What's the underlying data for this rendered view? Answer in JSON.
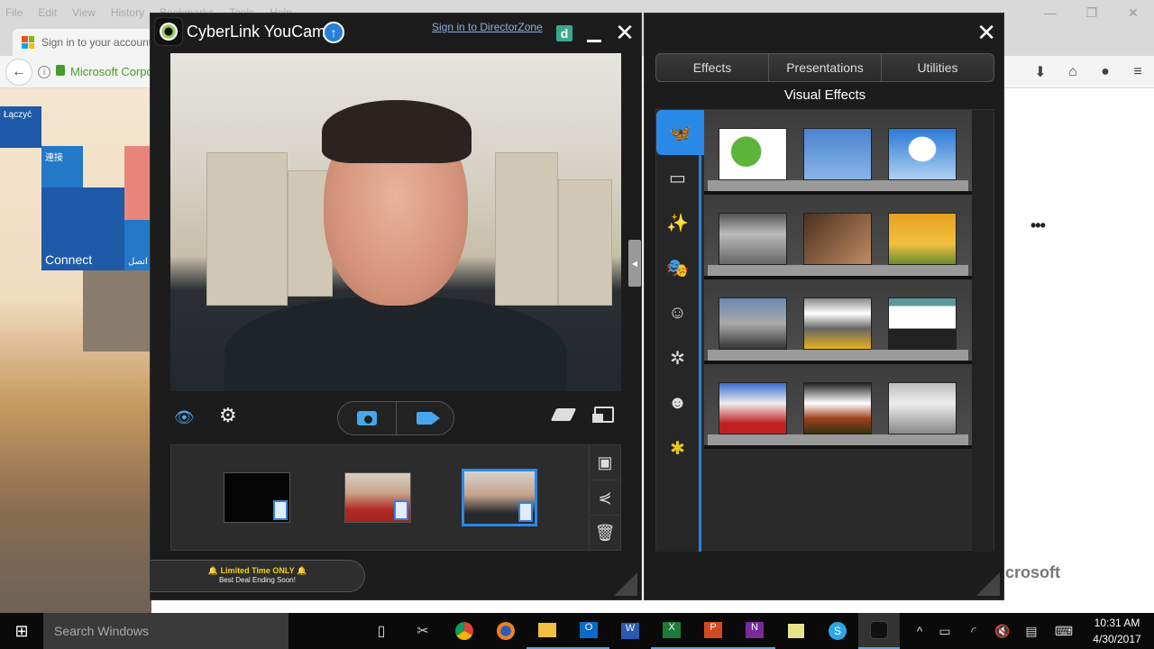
{
  "browser": {
    "menu": [
      "File",
      "Edit",
      "View",
      "History",
      "Bookmarks",
      "Tools",
      "Help"
    ],
    "tab_title": "Sign in to your account",
    "url_identity": "Microsoft Corpo",
    "window_controls": [
      "minimize",
      "restore",
      "close"
    ],
    "toolbar_icons": [
      "pocket-icon",
      "download-icon",
      "home-icon",
      "extensions-icon",
      "menu-icon"
    ],
    "tiles": [
      "Łączyć",
      "連接",
      "Connect",
      "اتصل"
    ],
    "more_label": "•••",
    "footer_logo_text": "Microsoft"
  },
  "youcam": {
    "title": "CyberLink YouCam",
    "signin_link": "Sign in to DirectorZone",
    "directorzone_icon_letter": "d",
    "controls": {
      "left": [
        "eye-icon",
        "settings-gear-icon"
      ],
      "capture": [
        "snapshot-camera-icon",
        "record-video-icon"
      ],
      "right": [
        "eraser-icon",
        "window-mode-icon"
      ]
    },
    "gallery": {
      "items": [
        {
          "type": "video",
          "description": "black video clip",
          "selected": false
        },
        {
          "type": "video",
          "description": "man in red shirt",
          "selected": false
        },
        {
          "type": "video",
          "description": "man in kitchen",
          "selected": true
        }
      ],
      "side_actions": [
        "import-to-gallery-icon",
        "share-icon",
        "delete-icon"
      ]
    },
    "promo": {
      "line1": "Limited Time ONLY",
      "line2": "Best Deal Ending Soon!"
    }
  },
  "effects": {
    "tabs": [
      "Effects",
      "Presentations",
      "Utilities"
    ],
    "active_tab": "Effects",
    "heading": "Visual Effects",
    "categories": [
      "scenes-icon",
      "frames-icon",
      "magic-wand-icon",
      "mask-icon",
      "emoticon-avatar-icon",
      "particles-icon",
      "smiley-icon",
      "special-star-icon"
    ],
    "active_category": 0,
    "thumbnails": [
      [
        "download-more",
        "billboard-sign",
        "hot-air-balloon"
      ],
      [
        "station-screens",
        "hand-card",
        "autumn-easel"
      ],
      [
        "subway-billboards",
        "times-square-taxis",
        "window-washers"
      ],
      [
        "piccadilly-circus",
        "theater-stage",
        "skyscraper-billboard"
      ]
    ]
  },
  "taskbar": {
    "search_placeholder": "Search Windows",
    "apps": [
      "task-view",
      "snipping-tool",
      "chrome",
      "firefox",
      "file-explorer",
      "outlook",
      "word",
      "excel",
      "powerpoint",
      "onenote",
      "sticky-notes",
      "skype",
      "youcam"
    ],
    "tray": [
      "chevron-up",
      "battery",
      "wifi",
      "volume-muted",
      "action-center",
      "keyboard"
    ],
    "time": "10:31 AM",
    "date": "4/30/2017"
  }
}
